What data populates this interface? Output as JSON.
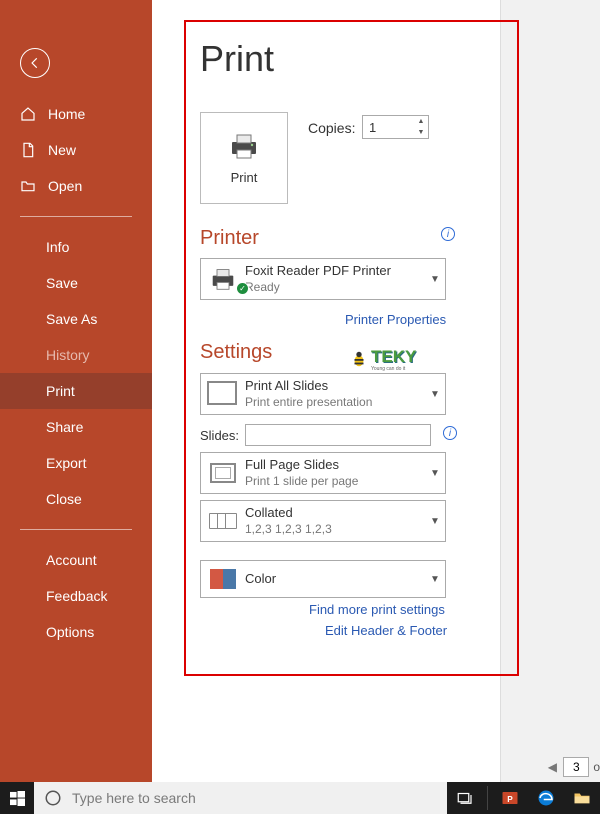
{
  "sidebar": {
    "items": [
      {
        "label": "Home",
        "icon": "home"
      },
      {
        "label": "New",
        "icon": "new"
      },
      {
        "label": "Open",
        "icon": "open"
      }
    ],
    "items2": [
      {
        "label": "Info"
      },
      {
        "label": "Save"
      },
      {
        "label": "Save As"
      },
      {
        "label": "History",
        "dim": true
      },
      {
        "label": "Print",
        "active": true
      },
      {
        "label": "Share"
      },
      {
        "label": "Export"
      },
      {
        "label": "Close"
      }
    ],
    "items3": [
      {
        "label": "Account"
      },
      {
        "label": "Feedback"
      },
      {
        "label": "Options"
      }
    ]
  },
  "main": {
    "title": "Print",
    "print_button": "Print",
    "copies_label": "Copies:",
    "copies_value": "1",
    "printer_section": "Printer",
    "printer": {
      "name": "Foxit Reader PDF Printer",
      "status": "Ready"
    },
    "printer_properties": "Printer Properties",
    "settings_section": "Settings",
    "slides_combo": {
      "t1": "Print All Slides",
      "t2": "Print entire presentation"
    },
    "slides_label": "Slides:",
    "slides_value": "",
    "layout_combo": {
      "t1": "Full Page Slides",
      "t2": "Print 1 slide per page"
    },
    "collate_combo": {
      "t1": "Collated",
      "t2": "1,2,3    1,2,3    1,2,3"
    },
    "color_combo": {
      "t1": "Color"
    },
    "find_more": "Find more print settings",
    "edit_hf": "Edit Header & Footer",
    "watermark": "TEKY",
    "watermark_sub": "Young can do it"
  },
  "page_nav": {
    "current": "3",
    "of": "o"
  },
  "taskbar": {
    "search_placeholder": "Type here to search"
  }
}
